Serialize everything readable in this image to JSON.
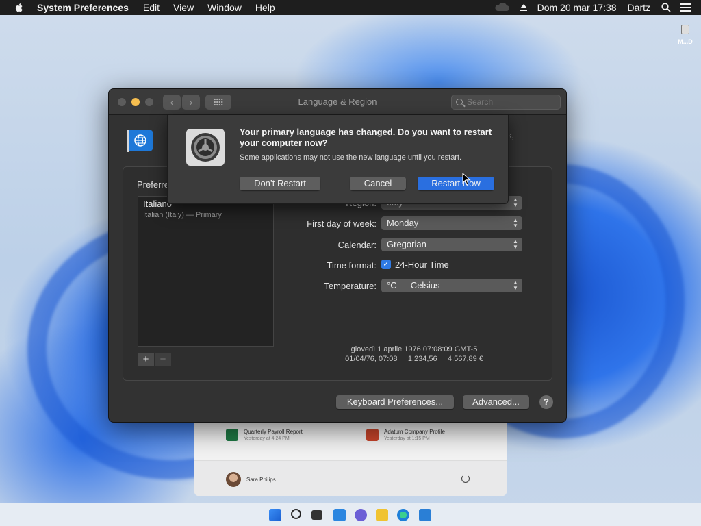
{
  "menubar": {
    "app_name": "System Preferences",
    "menus": [
      "Edit",
      "View",
      "Window",
      "Help"
    ],
    "clock": "Dom 20 mar  17:38",
    "user": "Dartz"
  },
  "desktop": {
    "icon_label": "M...D"
  },
  "start_panel": {
    "recent": [
      {
        "name": "Quarterly Payroll Report",
        "time": "Yesterday at 4:24 PM"
      },
      {
        "name": "Adatum Company Profile",
        "time": "Yesterday at 1:15 PM"
      }
    ],
    "user_name": "Sara Philips"
  },
  "window": {
    "title": "Language & Region",
    "search_placeholder": "Search",
    "partial_heading": "s,",
    "group_label": "Preferre",
    "languages": [
      {
        "name": "Italiano",
        "sub": "Italian (Italy) — Primary"
      }
    ],
    "fields": {
      "region": {
        "label": "Region:",
        "value": "Italy"
      },
      "first_day": {
        "label": "First day of week:",
        "value": "Monday"
      },
      "calendar": {
        "label": "Calendar:",
        "value": "Gregorian"
      },
      "time_format": {
        "label": "Time format:",
        "value": "24-Hour Time",
        "checked": true
      },
      "temperature": {
        "label": "Temperature:",
        "value": "°C — Celsius"
      }
    },
    "sample_line1": "giovedì 1 aprile 1976 07:08:09 GMT-5",
    "sample_line2": "01/04/76, 07:08     1.234,56     4.567,89 €",
    "keyboard_button": "Keyboard Preferences...",
    "advanced_button": "Advanced...",
    "help_button": "?"
  },
  "sheet": {
    "title": "Your primary language has changed. Do you want to restart your computer now?",
    "body": "Some applications may not use the new language until you restart.",
    "dont_restart": "Don’t Restart",
    "cancel": "Cancel",
    "restart_now": "Restart Now"
  },
  "colors": {
    "accent": "#2a6fe0",
    "window_bg": "#323232",
    "menubar_bg": "#1e1e1e"
  }
}
